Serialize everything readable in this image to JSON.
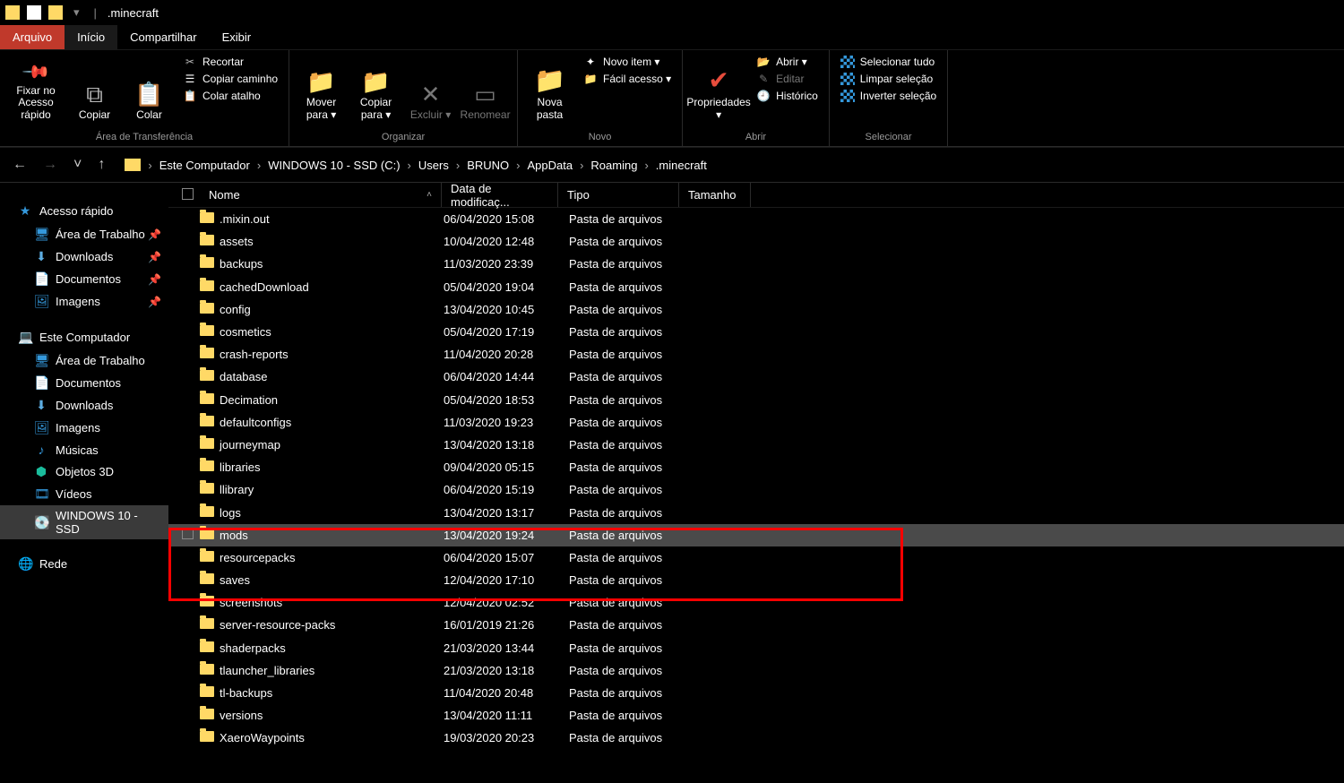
{
  "titlebar": {
    "title": ".minecraft",
    "sep": "|",
    "menu": "▾"
  },
  "tabs": {
    "file": "Arquivo",
    "home": "Início",
    "share": "Compartilhar",
    "view": "Exibir"
  },
  "ribbon": {
    "clipboard": {
      "label": "Área de Transferência",
      "pin": "Fixar no Acesso rápido",
      "copy": "Copiar",
      "paste": "Colar",
      "cut": "Recortar",
      "copypath": "Copiar caminho",
      "pasteshortcut": "Colar atalho"
    },
    "organize": {
      "label": "Organizar",
      "moveto": "Mover para",
      "copyto": "Copiar para",
      "delete": "Excluir",
      "rename": "Renomear"
    },
    "new": {
      "label": "Novo",
      "newfolder": "Nova pasta",
      "newitem": "Novo item",
      "easyaccess": "Fácil acesso"
    },
    "open": {
      "label": "Abrir",
      "properties": "Propriedades",
      "open": "Abrir",
      "edit": "Editar",
      "history": "Histórico"
    },
    "select": {
      "label": "Selecionar",
      "selectall": "Selecionar tudo",
      "selectnone": "Limpar seleção",
      "invert": "Inverter seleção"
    }
  },
  "breadcrumb": {
    "items": [
      "Este Computador",
      "WINDOWS 10 - SSD (C:)",
      "Users",
      "BRUNO",
      "AppData",
      "Roaming",
      ".minecraft"
    ]
  },
  "sidebar": {
    "quickaccess": "Acesso rápido",
    "qa_items": [
      {
        "label": "Área de Trabalho",
        "pinned": true
      },
      {
        "label": "Downloads",
        "pinned": true
      },
      {
        "label": "Documentos",
        "pinned": true
      },
      {
        "label": "Imagens",
        "pinned": true
      }
    ],
    "thispc": "Este Computador",
    "pc_items": [
      "Área de Trabalho",
      "Documentos",
      "Downloads",
      "Imagens",
      "Músicas",
      "Objetos 3D",
      "Vídeos",
      "WINDOWS 10 - SSD"
    ],
    "network": "Rede"
  },
  "columns": {
    "name": "Nome",
    "date": "Data de modificaç...",
    "type": "Tipo",
    "size": "Tamanho"
  },
  "rows": [
    {
      "name": ".mixin.out",
      "date": "06/04/2020 15:08",
      "type": "Pasta de arquivos"
    },
    {
      "name": "assets",
      "date": "10/04/2020 12:48",
      "type": "Pasta de arquivos"
    },
    {
      "name": "backups",
      "date": "11/03/2020 23:39",
      "type": "Pasta de arquivos"
    },
    {
      "name": "cachedDownload",
      "date": "05/04/2020 19:04",
      "type": "Pasta de arquivos"
    },
    {
      "name": "config",
      "date": "13/04/2020 10:45",
      "type": "Pasta de arquivos"
    },
    {
      "name": "cosmetics",
      "date": "05/04/2020 17:19",
      "type": "Pasta de arquivos"
    },
    {
      "name": "crash-reports",
      "date": "11/04/2020 20:28",
      "type": "Pasta de arquivos"
    },
    {
      "name": "database",
      "date": "06/04/2020 14:44",
      "type": "Pasta de arquivos"
    },
    {
      "name": "Decimation",
      "date": "05/04/2020 18:53",
      "type": "Pasta de arquivos"
    },
    {
      "name": "defaultconfigs",
      "date": "11/03/2020 19:23",
      "type": "Pasta de arquivos"
    },
    {
      "name": "journeymap",
      "date": "13/04/2020 13:18",
      "type": "Pasta de arquivos"
    },
    {
      "name": "libraries",
      "date": "09/04/2020 05:15",
      "type": "Pasta de arquivos"
    },
    {
      "name": "llibrary",
      "date": "06/04/2020 15:19",
      "type": "Pasta de arquivos"
    },
    {
      "name": "logs",
      "date": "13/04/2020 13:17",
      "type": "Pasta de arquivos"
    },
    {
      "name": "mods",
      "date": "13/04/2020 19:24",
      "type": "Pasta de arquivos",
      "selected": true
    },
    {
      "name": "resourcepacks",
      "date": "06/04/2020 15:07",
      "type": "Pasta de arquivos"
    },
    {
      "name": "saves",
      "date": "12/04/2020 17:10",
      "type": "Pasta de arquivos"
    },
    {
      "name": "screenshots",
      "date": "12/04/2020 02:52",
      "type": "Pasta de arquivos"
    },
    {
      "name": "server-resource-packs",
      "date": "16/01/2019 21:26",
      "type": "Pasta de arquivos"
    },
    {
      "name": "shaderpacks",
      "date": "21/03/2020 13:44",
      "type": "Pasta de arquivos"
    },
    {
      "name": "tlauncher_libraries",
      "date": "21/03/2020 13:18",
      "type": "Pasta de arquivos"
    },
    {
      "name": "tl-backups",
      "date": "11/04/2020 20:48",
      "type": "Pasta de arquivos"
    },
    {
      "name": "versions",
      "date": "13/04/2020 11:11",
      "type": "Pasta de arquivos"
    },
    {
      "name": "XaeroWaypoints",
      "date": "19/03/2020 20:23",
      "type": "Pasta de arquivos"
    }
  ]
}
